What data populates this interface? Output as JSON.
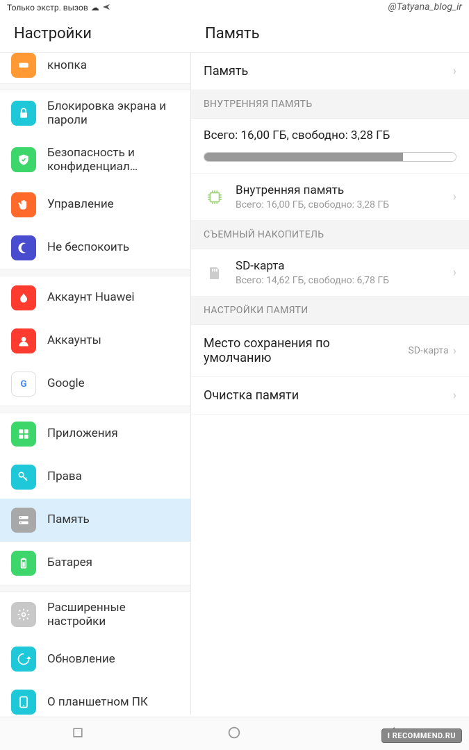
{
  "status_bar": {
    "text": "Только экстр. вызов",
    "cloud_icon": "☁",
    "plane_icon": "✈"
  },
  "watermark_top": "@Tatyana_blog_ir",
  "watermark_bottom": "I RECOMMEND.RU",
  "sidebar": {
    "title": "Настройки",
    "items": [
      {
        "label": "кнопка",
        "icon": "button",
        "bg": "#ff9933"
      },
      {
        "sep": true
      },
      {
        "label": "Блокировка экрана и пароли",
        "icon": "lock",
        "bg": "#1ec8d8"
      },
      {
        "label": "Безопасность и конфиденциал…",
        "icon": "shield",
        "bg": "#3dd66a"
      },
      {
        "label": "Управление",
        "icon": "hand",
        "bg": "#ff6a2b"
      },
      {
        "label": "Не беспокоить",
        "icon": "moon",
        "bg": "#4a4cd0"
      },
      {
        "sep": true
      },
      {
        "label": "Аккаунт Huawei",
        "icon": "huawei",
        "bg": "#ff3b30"
      },
      {
        "label": "Аккаунты",
        "icon": "person",
        "bg": "#ff3b30"
      },
      {
        "label": "Google",
        "icon": "google",
        "bg": "#fff"
      },
      {
        "sep": true
      },
      {
        "label": "Приложения",
        "icon": "apps",
        "bg": "#3dd66a"
      },
      {
        "label": "Права",
        "icon": "key",
        "bg": "#1ec8d8"
      },
      {
        "label": "Память",
        "icon": "storage",
        "bg": "#a8a8a8",
        "selected": true
      },
      {
        "label": "Батарея",
        "icon": "battery",
        "bg": "#3dd66a"
      },
      {
        "sep": true
      },
      {
        "label": "Расширенные настройки",
        "icon": "gear",
        "bg": "#c8c8c8"
      },
      {
        "label": "Обновление",
        "icon": "update",
        "bg": "#1ec8d8"
      },
      {
        "label": "О планшетном ПК",
        "icon": "info",
        "bg": "#1ec8d8"
      }
    ]
  },
  "content": {
    "title": "Память",
    "memory_row": "Память",
    "section_internal": "ВНУТРЕННЯЯ ПАМЯТЬ",
    "storage_total_text": "Всего: 16,00 ГБ, свободно: 3,28 ГБ",
    "progress_percent": 79,
    "internal": {
      "title": "Внутренняя память",
      "sub": "Всего: 16,00 ГБ, свободно: 3,28 ГБ"
    },
    "section_removable": "СЪЕМНЫЙ НАКОПИТЕЛЬ",
    "sd": {
      "title": "SD-карта",
      "sub": "Всего: 14,62 ГБ, свободно: 6,78 ГБ"
    },
    "section_settings": "НАСТРОЙКИ ПАМЯТИ",
    "default_location": {
      "label": "Место сохранения по умолчанию",
      "value": "SD-карта"
    },
    "cleanup": "Очистка памяти"
  }
}
